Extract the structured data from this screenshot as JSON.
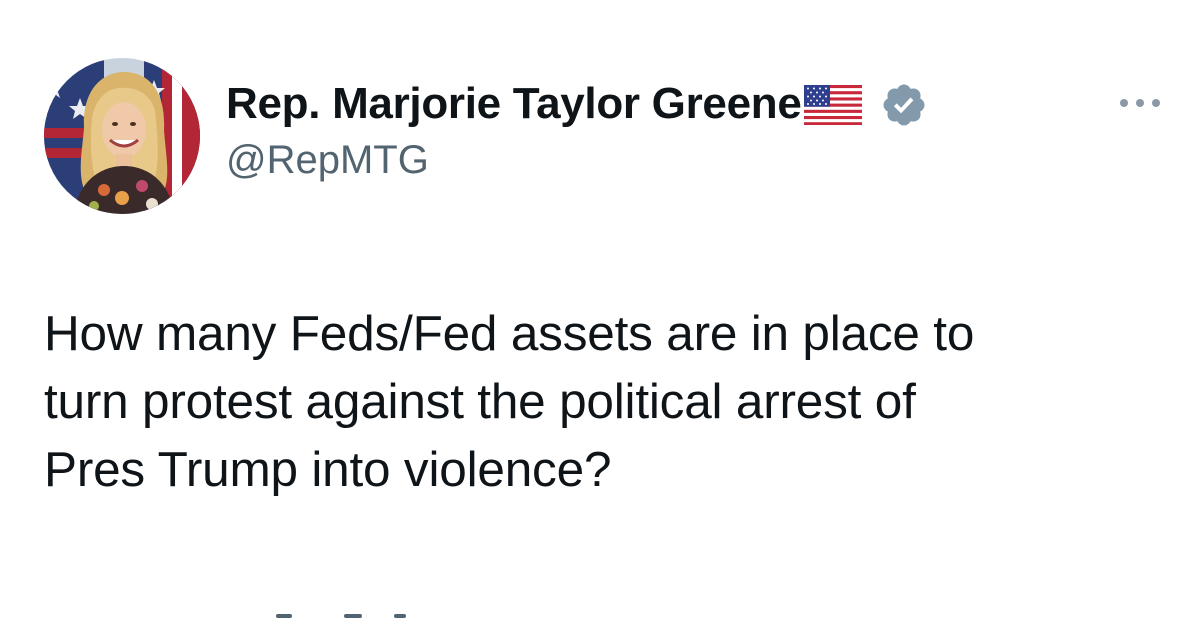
{
  "author": {
    "display_name": "Rep. Marjorie Taylor Greene",
    "name_emoji": "us-flag-emoji",
    "handle": "@RepMTG",
    "verified_icon": "verified-badge-icon",
    "verified_color": "#829aab",
    "avatar": "profile-photo"
  },
  "tweet": {
    "lines": [
      "How many Feds/Fed assets are in place to",
      "turn protest against the political arrest of",
      "Pres Trump into violence?"
    ]
  },
  "menu": {
    "icon": "more-options-icon"
  },
  "colors": {
    "text": "#0f1419",
    "secondary": "#536471"
  }
}
